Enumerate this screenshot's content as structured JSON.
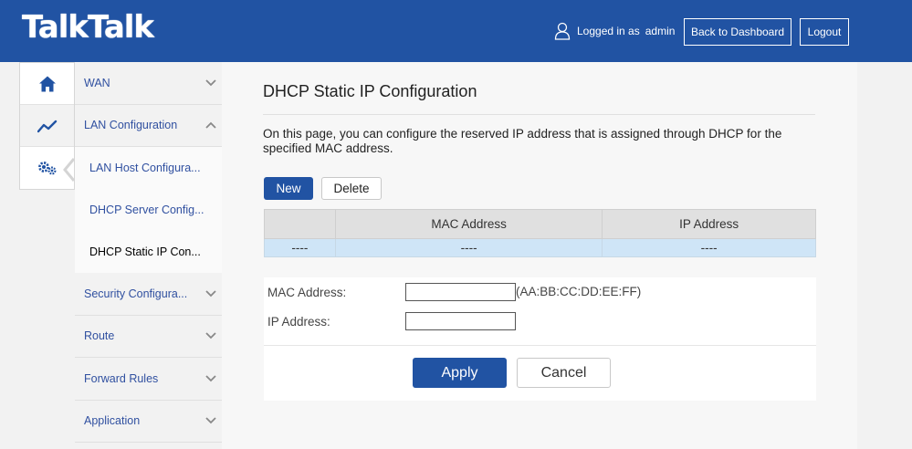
{
  "colors": {
    "brand": "#2153a3",
    "row_highlight": "#cfe5f7",
    "menu_text": "#3050a0"
  },
  "header": {
    "logo": "TalkTalk",
    "logged_in_label": "Logged in as",
    "username": "admin",
    "dashboard_button": "Back to Dashboard",
    "logout_button": "Logout",
    "user_icon": "user-icon"
  },
  "rail": {
    "items": [
      {
        "icon": "home-icon"
      },
      {
        "icon": "trend-chart-icon",
        "active": true
      },
      {
        "icon": "gears-icon"
      }
    ]
  },
  "menu": {
    "items": [
      {
        "label": "WAN",
        "expanded": false
      },
      {
        "label": "LAN Configuration",
        "expanded": true,
        "children": [
          "LAN Host Configura...",
          "DHCP Server Config...",
          "DHCP Static IP Con..."
        ]
      },
      {
        "label": "Security Configura...",
        "expanded": false
      },
      {
        "label": "Route",
        "expanded": false
      },
      {
        "label": "Forward Rules",
        "expanded": false
      },
      {
        "label": "Application",
        "expanded": false
      }
    ],
    "active_child": "DHCP Static IP Con..."
  },
  "main": {
    "title": "DHCP Static IP Configuration",
    "description": "On this page, you can configure the reserved IP address that is assigned through DHCP for the specified MAC address.",
    "new_button": "New",
    "delete_button": "Delete",
    "table": {
      "columns": [
        "",
        "MAC Address",
        "IP Address"
      ],
      "rows": [
        [
          "----",
          "----",
          "----"
        ]
      ]
    },
    "form": {
      "mac_label": "MAC Address:",
      "mac_value": "",
      "mac_hint": "(AA:BB:CC:DD:EE:FF)",
      "ip_label": "IP Address:",
      "ip_value": "",
      "apply_button": "Apply",
      "cancel_button": "Cancel"
    }
  }
}
